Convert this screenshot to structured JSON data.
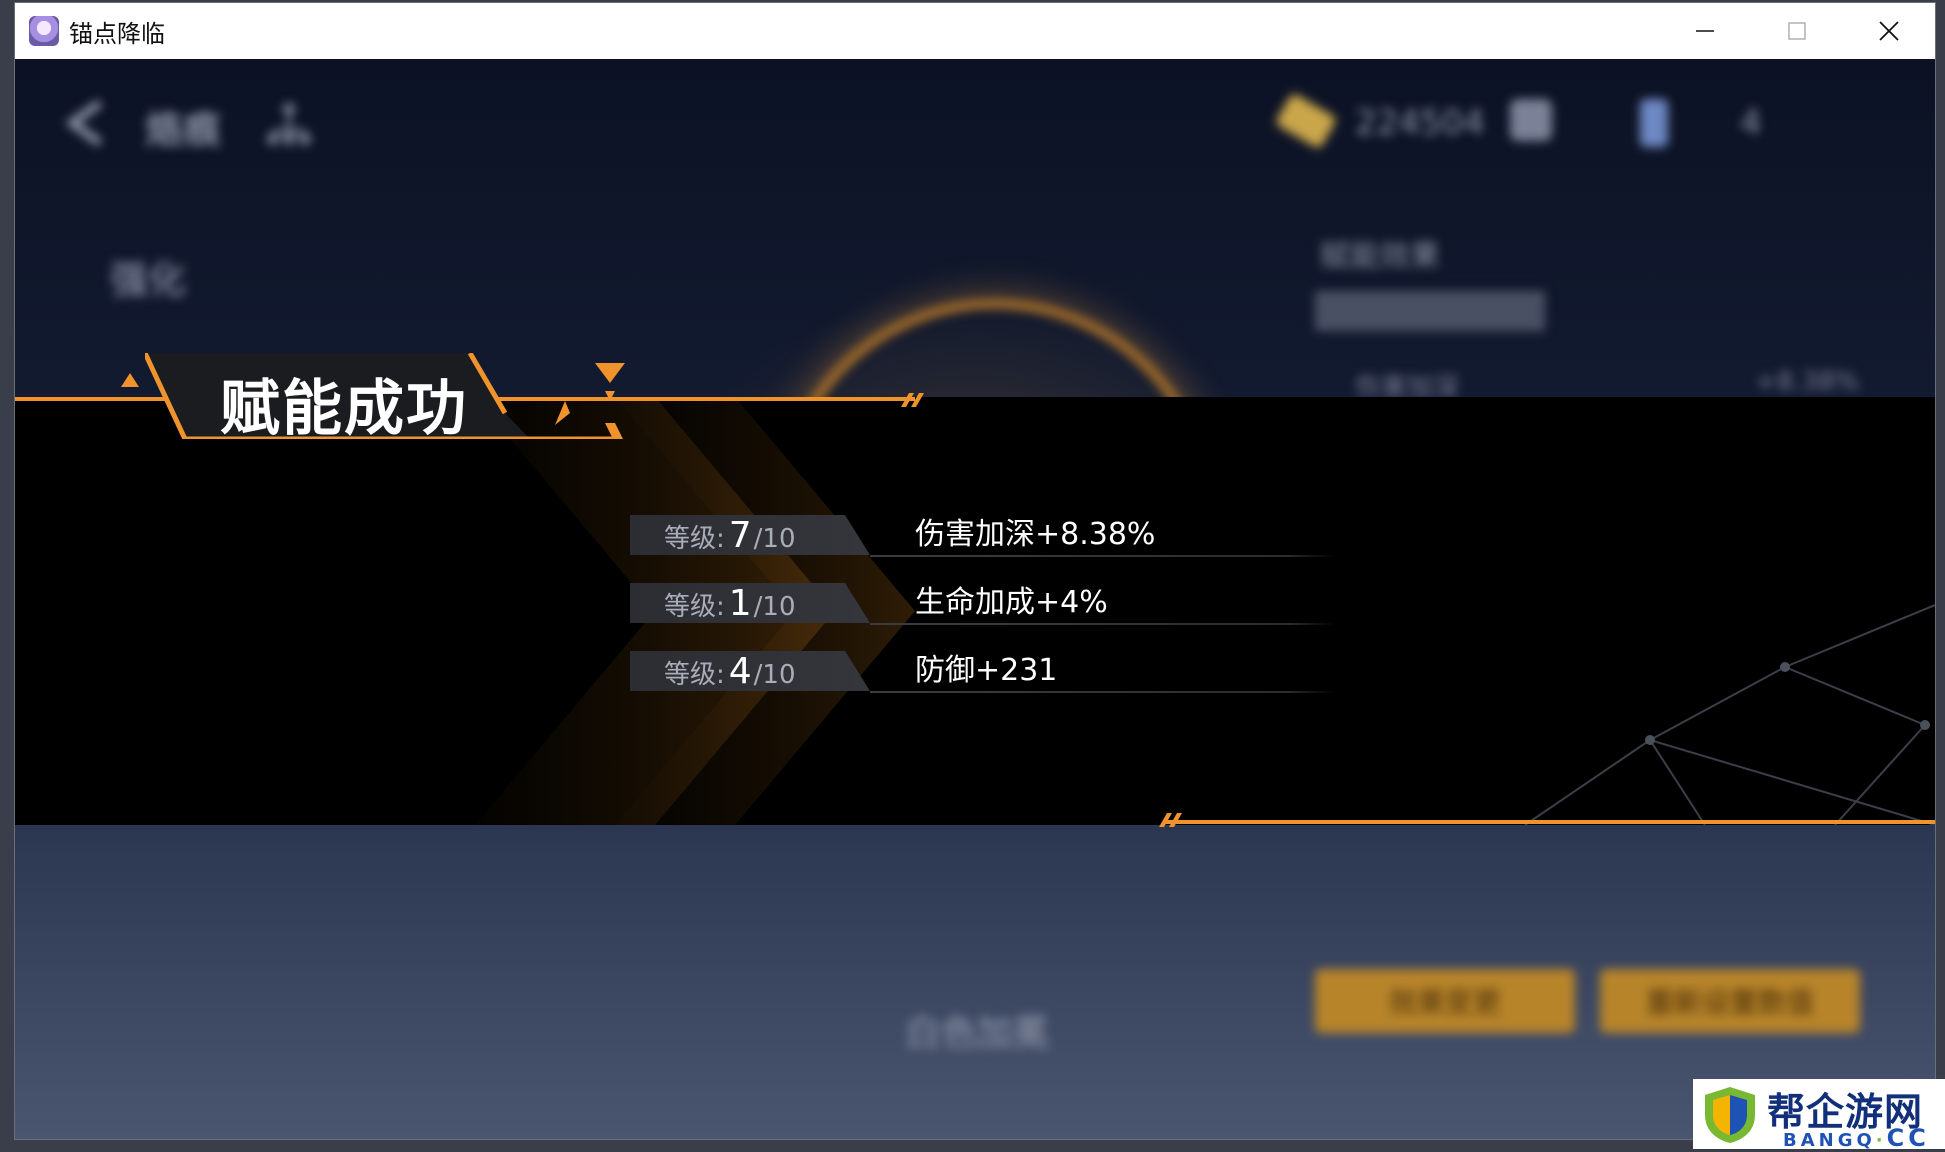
{
  "window": {
    "title": "锚点降临"
  },
  "background_ui": {
    "nav_label": "烙痕",
    "coin_amount": "224504",
    "potion_count": "4",
    "side_label": "强化",
    "panel_title": "赋能效果",
    "panel_row_label": "伤害加深",
    "panel_row_value": "+8.38%",
    "center_label": "白色加冕",
    "left_button": "效果变更",
    "right_button": "重新设置数值"
  },
  "result": {
    "title": "赋能成功",
    "level_prefix": "等级:",
    "rows": [
      {
        "level": "7",
        "max": "/10",
        "effect": "伤害加深+8.38%"
      },
      {
        "level": "1",
        "max": "/10",
        "effect": "生命加成+4%"
      },
      {
        "level": "4",
        "max": "/10",
        "effect": "防御+231"
      }
    ]
  },
  "watermark": {
    "main": "帮企游网",
    "sub_left": "BANGQ",
    "sub_dot": "·",
    "sub_right": "CC"
  },
  "colors": {
    "accent": "#f0932c",
    "banner_bg": "#000000"
  }
}
